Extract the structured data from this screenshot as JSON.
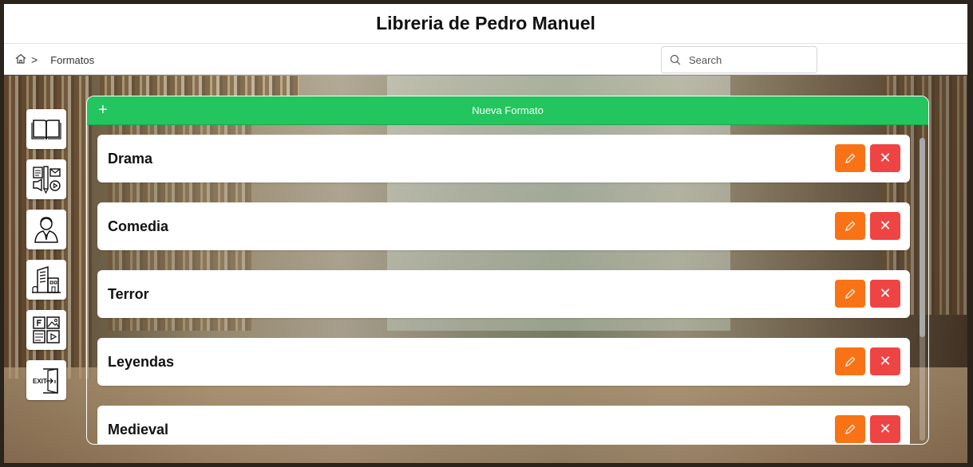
{
  "app": {
    "title": "Libreria de Pedro Manuel"
  },
  "breadcrumb": {
    "current": "Formatos",
    "separator": ">"
  },
  "search": {
    "placeholder": "Search",
    "value": ""
  },
  "sidebar": {
    "items": [
      {
        "icon": "book-icon",
        "label": "Libros"
      },
      {
        "icon": "media-formats-icon",
        "label": "Formatos"
      },
      {
        "icon": "author-icon",
        "label": "Autores"
      },
      {
        "icon": "building-icon",
        "label": "Editoriales"
      },
      {
        "icon": "genres-icon",
        "label": "Generos"
      },
      {
        "icon": "exit-icon",
        "label": "Salir"
      }
    ]
  },
  "panel": {
    "new_label": "Nueva Formato",
    "new_icon": "+",
    "items": [
      {
        "name": "Drama"
      },
      {
        "name": "Comedia"
      },
      {
        "name": "Terror"
      },
      {
        "name": "Leyendas"
      },
      {
        "name": "Medieval"
      }
    ],
    "edit_icon": "pencil-icon",
    "delete_icon": "close-icon",
    "delete_glyph": "✕"
  },
  "colors": {
    "accent_green": "#22c55e",
    "edit_orange": "#f97316",
    "delete_red": "#ef4444"
  },
  "exit_text": "EXIT"
}
